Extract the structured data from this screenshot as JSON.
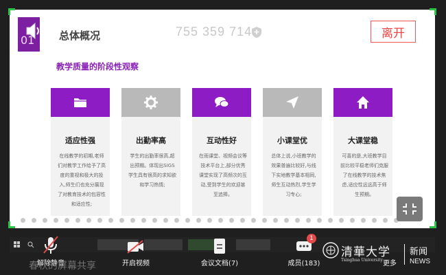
{
  "meeting": {
    "id": "755 359 714",
    "leave_label": "离开"
  },
  "slide": {
    "number": "01",
    "title": "总体概况",
    "subtitle": "教学质量的阶段性观察",
    "cards": [
      {
        "title": "适应性强",
        "icon": "folder-icon",
        "header": "purple",
        "desc": "在线教学的初期,老师们对教学工作给予了高度的重视和极大的投入,师生们也充分展现了对教育技术的包容性和适应性;"
      },
      {
        "title": "出勤率高",
        "icon": "gear-icon",
        "header": "gray",
        "desc": "学生的出勤率很高,超出预期。体现出SIGS学生具有很高的求知欲和学习热情;"
      },
      {
        "title": "互动性好",
        "icon": "chat-icon",
        "header": "purple",
        "desc": "在雨课堂、视频会议等技术平台上,部分优秀课堂实现了高频次的互动,受到学生的欢迎甚至追捧。"
      },
      {
        "title": "小课堂优",
        "icon": "send-icon",
        "header": "gray",
        "desc": "总体上说,小班教学的效果普遍比较好,与线下实地教学基本相同,师生互动热烈,学生学习专心;"
      },
      {
        "title": "大课堂稳",
        "icon": "home-icon",
        "header": "purple",
        "desc": "可喜的是,大班教学目前比较平稳老师们克服了在线教学的技术焦虑,适应性远远高于师生预期。"
      }
    ]
  },
  "toolbar": {
    "mute_label": "解除静音",
    "video_label": "开启视频",
    "docs_label": "会议文档(7)",
    "members_label": "成员(183)",
    "more_label": "更多",
    "members_badge": "1",
    "caption": "春秋的屏幕共享"
  },
  "branding": {
    "logo_cn": "清華大学",
    "logo_en": "Tsinghua University",
    "news_cn": "新闻",
    "news_en": "NEWS"
  },
  "colors": {
    "accent_purple": "#8e1cc4",
    "leave_red": "#e44444",
    "share_border_green": "#2fc34a"
  }
}
